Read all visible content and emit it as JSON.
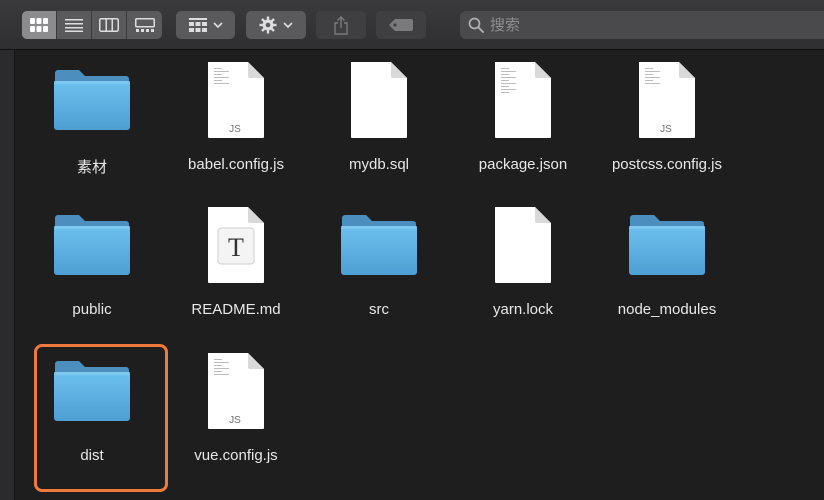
{
  "toolbar": {
    "view_buttons": [
      {
        "name": "icon-view",
        "icon": "grid-icon",
        "active": true
      },
      {
        "name": "list-view",
        "icon": "list-icon",
        "active": false
      },
      {
        "name": "column-view",
        "icon": "columns-icon",
        "active": false
      },
      {
        "name": "gallery-view",
        "icon": "gallery-icon",
        "active": false
      }
    ],
    "group_button": {
      "icon": "group-grid-icon",
      "chevron": "chevron-down-icon"
    },
    "action_button": {
      "icon": "gear-icon",
      "chevron": "chevron-down-icon"
    },
    "share_button": {
      "icon": "share-icon",
      "enabled": false
    },
    "tag_button": {
      "icon": "tag-icon",
      "enabled": false
    }
  },
  "search": {
    "placeholder": "搜索",
    "value": ""
  },
  "files": [
    {
      "name": "素材",
      "type": "folder"
    },
    {
      "name": "babel.config.js",
      "type": "js"
    },
    {
      "name": "mydb.sql",
      "type": "blank"
    },
    {
      "name": "package.json",
      "type": "text"
    },
    {
      "name": "postcss.config.js",
      "type": "js"
    },
    {
      "name": "public",
      "type": "folder"
    },
    {
      "name": "README.md",
      "type": "markdown",
      "badge": "T"
    },
    {
      "name": "src",
      "type": "folder"
    },
    {
      "name": "yarn.lock",
      "type": "blank"
    },
    {
      "name": "node_modules",
      "type": "folder"
    },
    {
      "name": "dist",
      "type": "folder",
      "selected": true
    },
    {
      "name": "vue.config.js",
      "type": "js"
    }
  ],
  "js_badge": "JS",
  "colors": {
    "selection": "#f07a3d",
    "folder": "#5aaede",
    "background": "#1e1e1e"
  }
}
